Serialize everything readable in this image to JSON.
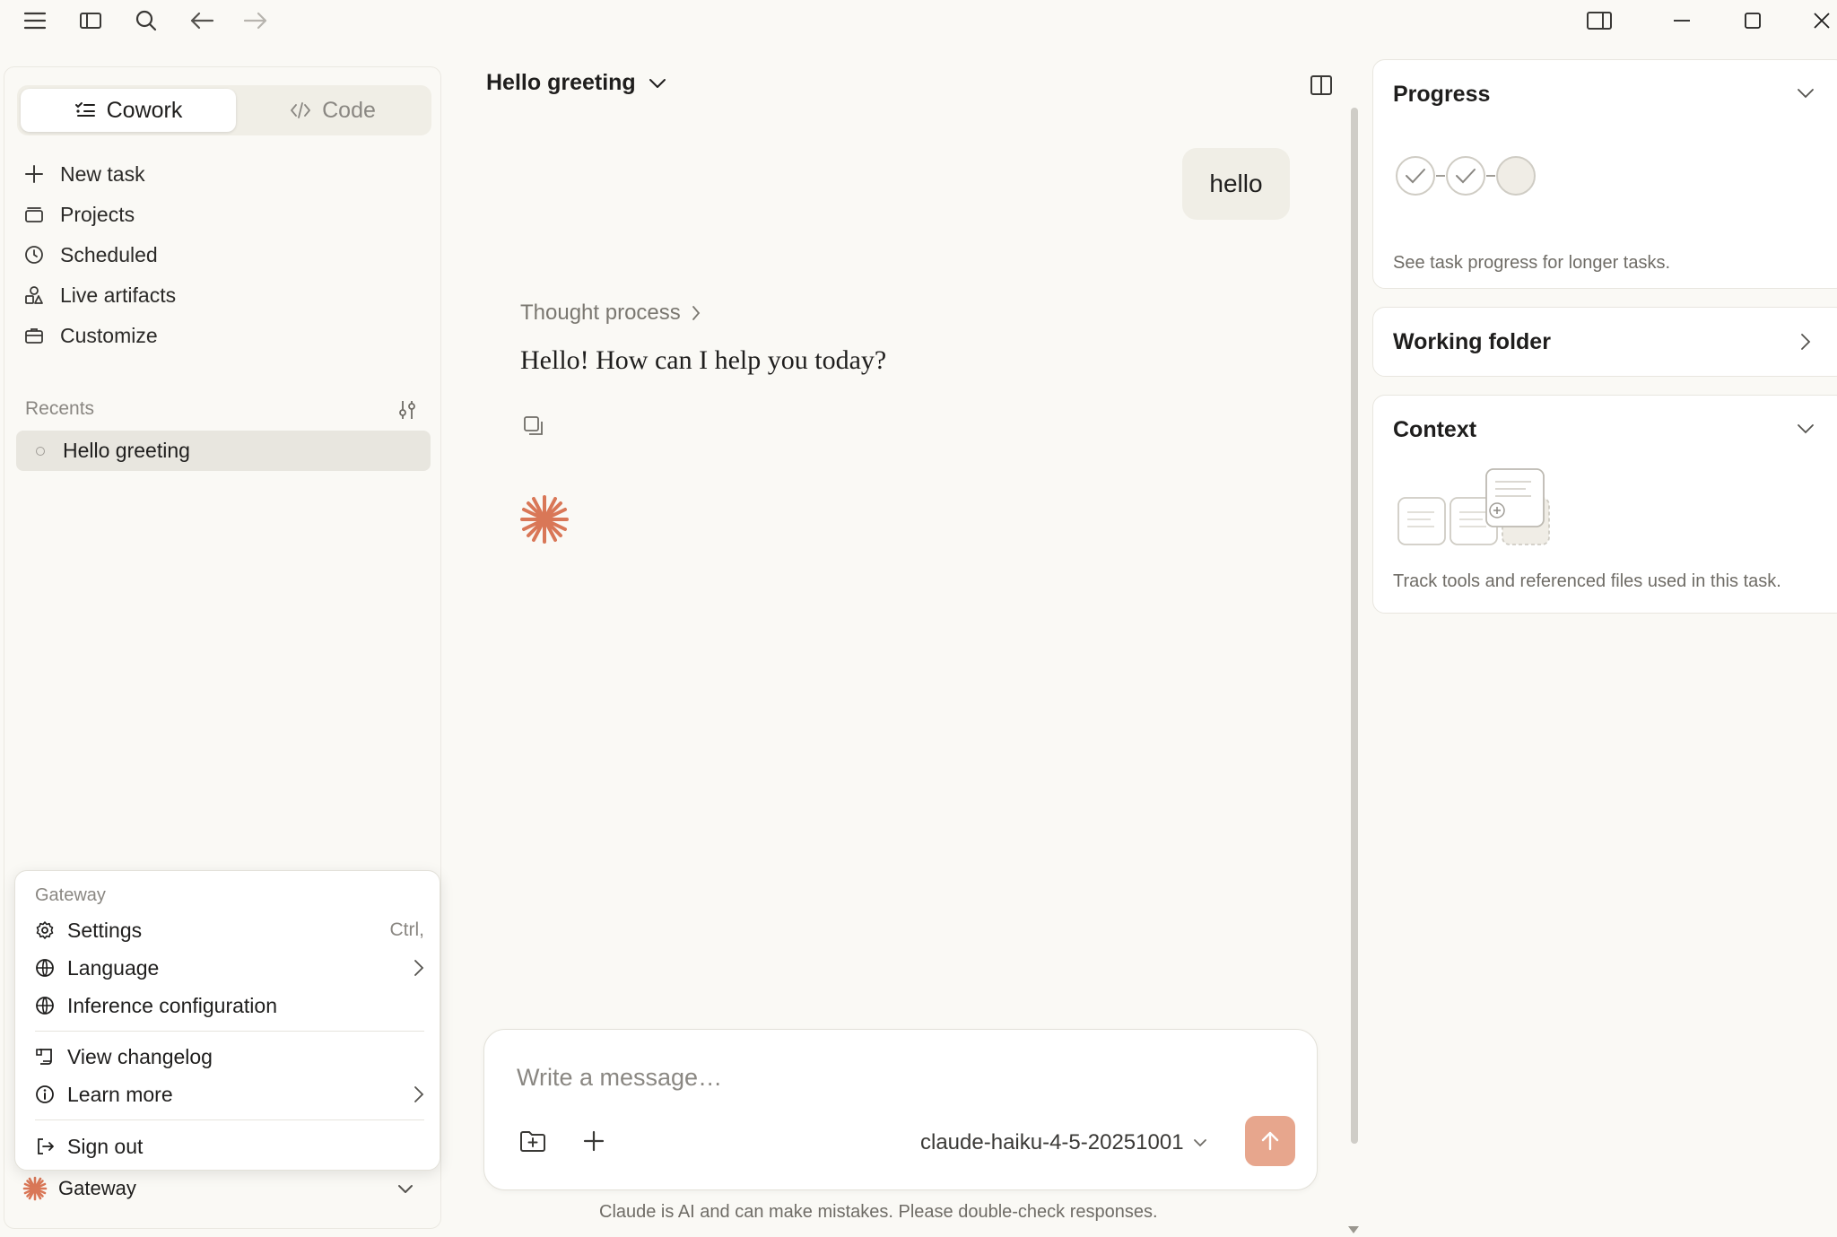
{
  "sidebar": {
    "modes": {
      "cowork": "Cowork",
      "code": "Code"
    },
    "nav": {
      "new_task": "New task",
      "projects": "Projects",
      "scheduled": "Scheduled",
      "live_artifacts": "Live artifacts",
      "customize": "Customize"
    },
    "recents_label": "Recents",
    "recents": [
      "Hello greeting"
    ],
    "account_label": "Gateway"
  },
  "menu": {
    "header": "Gateway",
    "settings": "Settings",
    "settings_shortcut": "Ctrl,",
    "language": "Language",
    "inference": "Inference configuration",
    "changelog": "View changelog",
    "learn_more": "Learn more",
    "sign_out": "Sign out"
  },
  "chat": {
    "title": "Hello greeting",
    "user_message": "hello",
    "thought_label": "Thought process",
    "assistant_message": "Hello! How can I help you today?",
    "input_placeholder": "Write a message…",
    "model": "claude-haiku-4-5-20251001",
    "disclaimer": "Claude is AI and can make mistakes. Please double-check responses."
  },
  "panel": {
    "progress": {
      "title": "Progress",
      "desc": "See task progress for longer tasks."
    },
    "working_folder": {
      "title": "Working folder"
    },
    "context": {
      "title": "Context",
      "desc": "Track tools and referenced files used in this task."
    }
  },
  "colors": {
    "accent": "#d97757",
    "send_button": "#e7a68d",
    "background": "#faf9f5"
  }
}
